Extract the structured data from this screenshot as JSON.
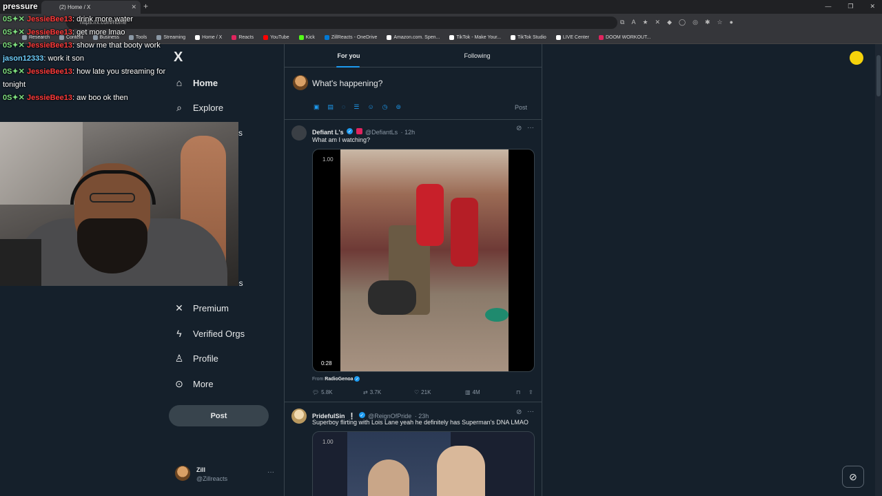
{
  "browser": {
    "tab_title": "(2) Home / X",
    "new_tab": "+",
    "url": "https://x.com/home",
    "window_controls": [
      "—",
      "❐",
      "✕"
    ],
    "bookmarks": [
      {
        "label": "Research",
        "color": "#8b98a5"
      },
      {
        "label": "Content",
        "color": "#8b98a5"
      },
      {
        "label": "Business",
        "color": "#8b98a5"
      },
      {
        "label": "Tools",
        "color": "#8b98a5"
      },
      {
        "label": "Streaming",
        "color": "#8b98a5"
      },
      {
        "label": "Home / X",
        "color": "#ffffff"
      },
      {
        "label": "Reacts",
        "color": "#e0245e"
      },
      {
        "label": "YouTube",
        "color": "#ff0000"
      },
      {
        "label": "Kick",
        "color": "#53fc18"
      },
      {
        "label": "ZillReacts - OneDrive",
        "color": "#0078d4"
      },
      {
        "label": "Amazon.com. Spen...",
        "color": "#ffffff"
      },
      {
        "label": "TikTok - Make Your...",
        "color": "#ffffff"
      },
      {
        "label": "TikTok Studio",
        "color": "#ffffff"
      },
      {
        "label": "LIVE Center",
        "color": "#ffffff"
      },
      {
        "label": "DOOM WORKOUT...",
        "color": "#e0245e"
      }
    ]
  },
  "nav": {
    "logo": "X",
    "items": [
      {
        "label": "Home",
        "icon": "home-icon"
      },
      {
        "label": "Explore",
        "icon": "search-icon"
      },
      {
        "label": "Premium",
        "icon": "x-icon"
      },
      {
        "label": "Verified Orgs",
        "icon": "lightning-icon"
      },
      {
        "label": "Profile",
        "icon": "person-icon"
      },
      {
        "label": "More",
        "icon": "more-circle-icon"
      }
    ],
    "partial_labels": [
      "s",
      "es"
    ],
    "post_button": "Post",
    "account": {
      "name": "Zill",
      "handle": "@Zillreacts",
      "more": "···"
    }
  },
  "feed": {
    "tabs": {
      "for_you": "For you",
      "following": "Following"
    },
    "compose": {
      "placeholder": "What's happening?",
      "post": "Post"
    },
    "tweets": [
      {
        "name": "Defiant L's",
        "handle": "@DefiantLs",
        "time": "· 12h",
        "text": "What am I watching?",
        "video_rate": "1.00",
        "video_time": "0:28",
        "from_label": "From",
        "from_source": "RadioGenoa",
        "replies": "5.8K",
        "reposts": "3.7K",
        "likes": "21K",
        "views": "4M"
      },
      {
        "name": "PridefulSin",
        "name_suffix": "❕",
        "handle": "@ReignOfPride",
        "time": "· 23h",
        "text": "Superboy flirting with Lois Lane yeah he definitely has Superman's DNA LMAO",
        "video_rate": "1.00"
      }
    ]
  },
  "chat": {
    "top_text": "pressure",
    "messages": [
      {
        "user": "JessieBee13",
        "user_color": "#ff3b3b",
        "text": ": drink more water"
      },
      {
        "user": "JessieBee13",
        "user_color": "#ff3b3b",
        "text": ": get more lmao"
      },
      {
        "user": "JessieBee13",
        "user_color": "#ff3b3b",
        "text": ": show me that booty work"
      },
      {
        "user": "jason12333",
        "user_color": "#6fd0ff",
        "text": ": work it son"
      },
      {
        "user": "JessieBee13",
        "user_color": "#ff3b3b",
        "text": ": how late you streaming for tonight"
      },
      {
        "user": "JessieBee13",
        "user_color": "#ff3b3b",
        "text": ": aw boo ok then"
      }
    ],
    "badge_text": "0S"
  },
  "colors": {
    "accent": "#1d9bf0",
    "background": "#15202b",
    "border": "#38444d"
  }
}
